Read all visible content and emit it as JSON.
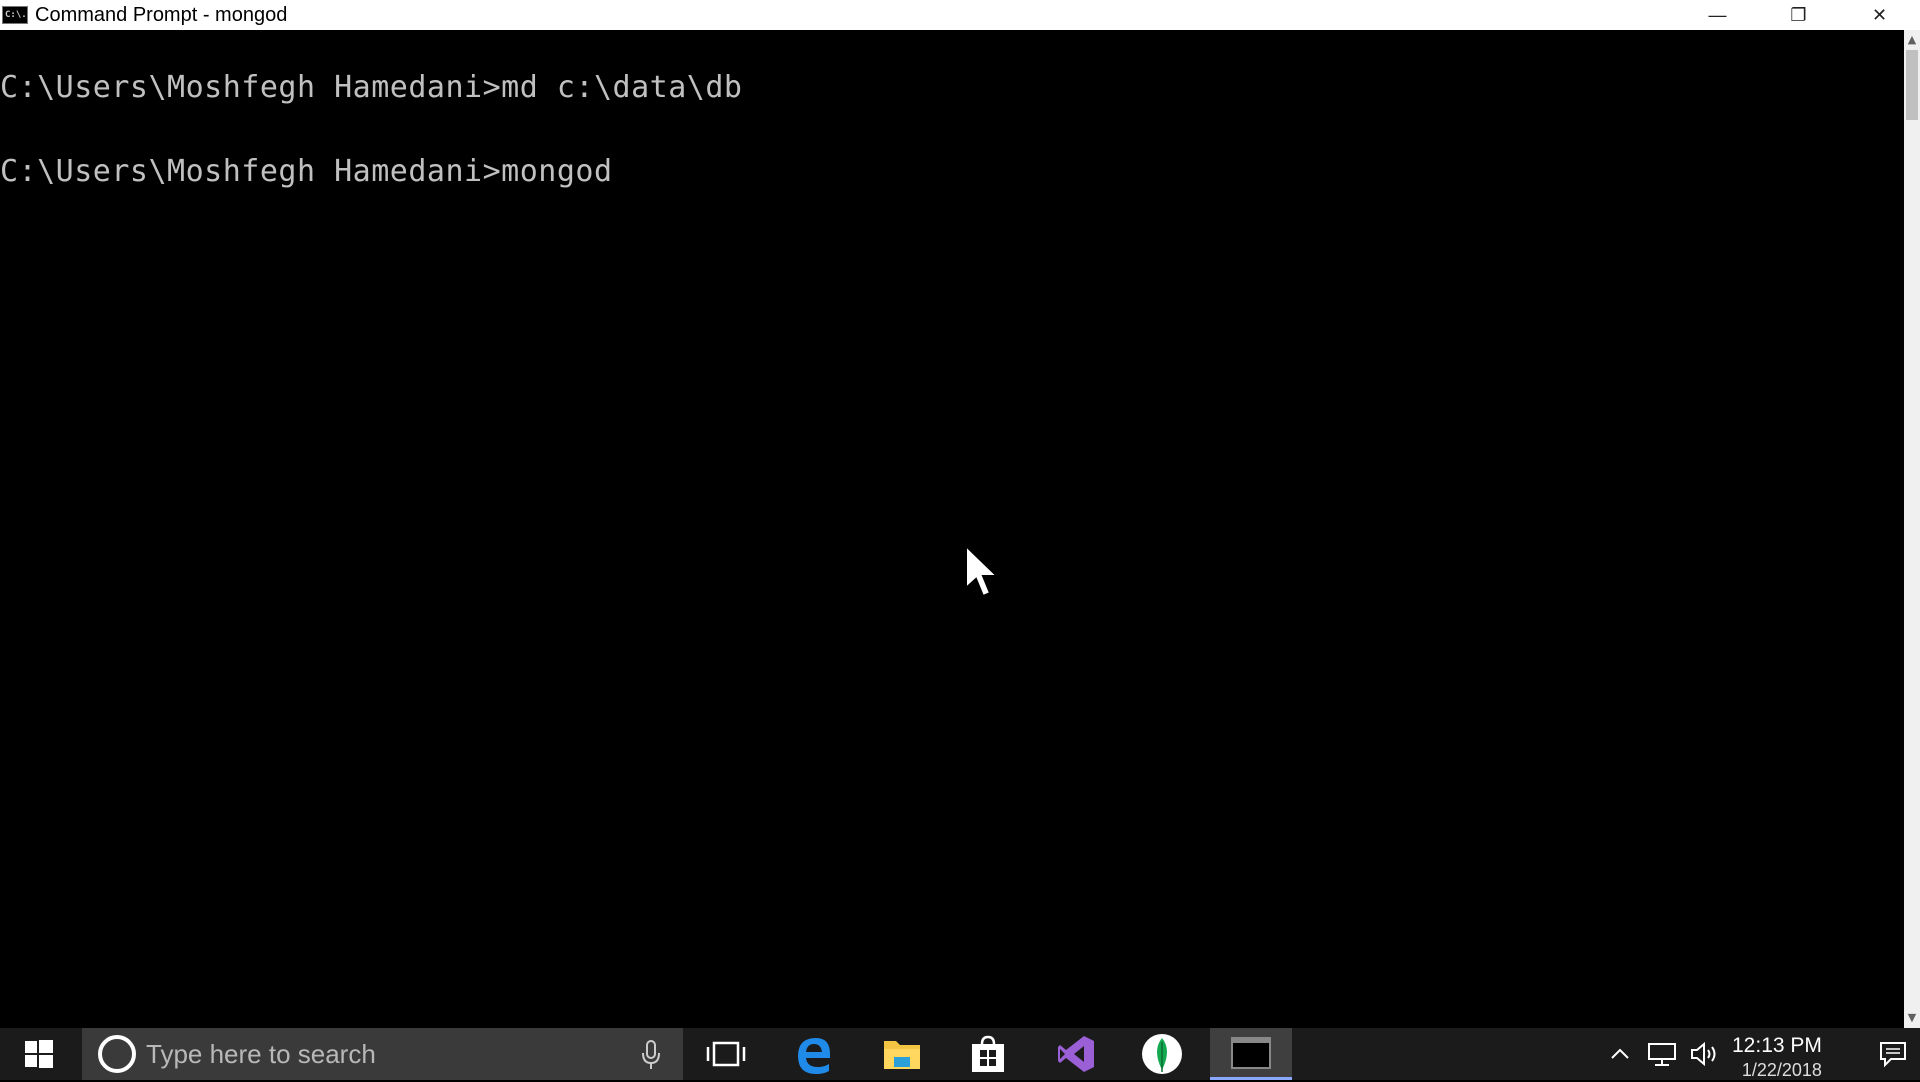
{
  "window": {
    "app_icon_text": "C:\\.",
    "title": "Command Prompt - mongod",
    "controls": {
      "minimize": "—",
      "restore": "❐",
      "close": "✕"
    }
  },
  "console": {
    "lines": [
      "C:\\Users\\Moshfegh Hamedani>md c:\\data\\db",
      "C:\\Users\\Moshfegh Hamedani>mongod"
    ],
    "text_color": "#c0c0c0",
    "background": "#000000"
  },
  "taskbar": {
    "search_placeholder": "Type here to search",
    "pinned_icons": [
      "windows-start-icon",
      "task-view-icon",
      "edge-icon",
      "file-explorer-icon",
      "store-icon",
      "visual-studio-icon",
      "mongodb-compass-icon",
      "command-prompt-icon"
    ],
    "clock": {
      "time": "12:13 PM",
      "date": "1/22/2018"
    },
    "accent_color": "#8aa8ff"
  }
}
